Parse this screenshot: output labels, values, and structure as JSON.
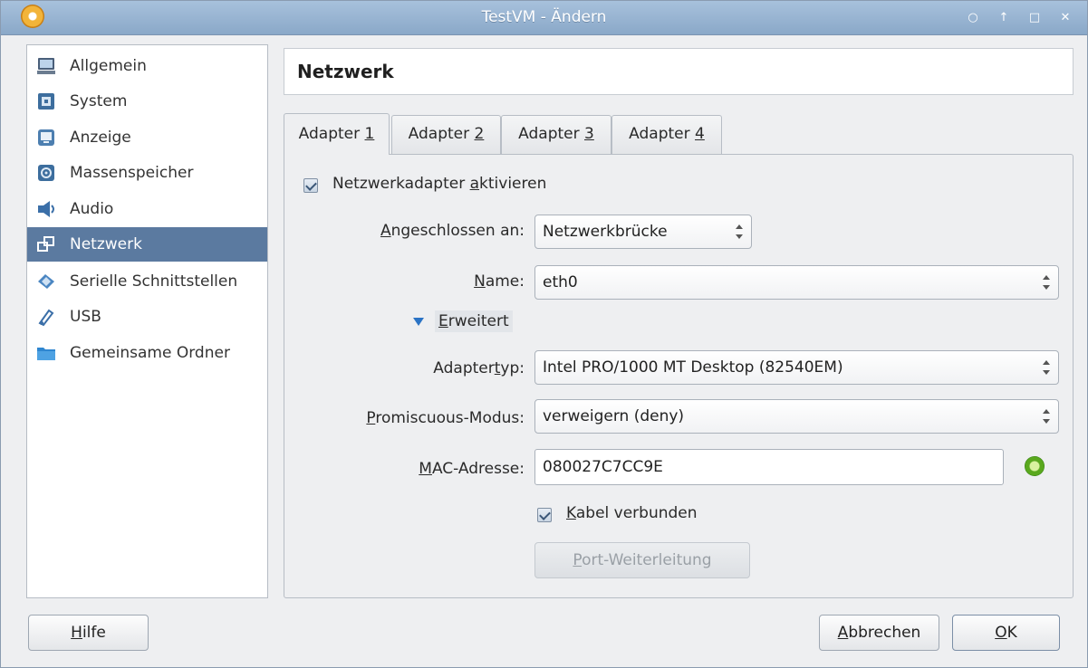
{
  "window": {
    "title": "TestVM - Ändern",
    "controls": [
      "○",
      "↑",
      "□",
      "✕"
    ]
  },
  "sidebar": {
    "items": [
      {
        "label": "Allgemein",
        "icon": "general-icon"
      },
      {
        "label": "System",
        "icon": "system-icon"
      },
      {
        "label": "Anzeige",
        "icon": "display-icon"
      },
      {
        "label": "Massenspeicher",
        "icon": "storage-icon"
      },
      {
        "label": "Audio",
        "icon": "audio-icon"
      },
      {
        "label": "Netzwerk",
        "icon": "network-icon"
      },
      {
        "label": "Serielle Schnittstellen",
        "icon": "serial-ports-icon"
      },
      {
        "label": "USB",
        "icon": "usb-icon"
      },
      {
        "label": "Gemeinsame Ordner",
        "icon": "shared-folders-icon"
      }
    ],
    "selected": "Netzwerk"
  },
  "header": {
    "title": "Netzwerk"
  },
  "tabs": [
    {
      "prefix": "Adapter ",
      "key": "1"
    },
    {
      "prefix": "Adapter ",
      "key": "2"
    },
    {
      "prefix": "Adapter ",
      "key": "3"
    },
    {
      "prefix": "Adapter ",
      "key": "4"
    }
  ],
  "adapter": {
    "enable": {
      "pre": "Netzwerkadapter ",
      "key": "a",
      "post": "ktivieren",
      "checked": true
    },
    "attached": {
      "key": "A",
      "rest": "ngeschlossen an:",
      "value": "Netzwerkbrücke"
    },
    "name": {
      "key": "N",
      "rest": "ame:",
      "value": "eth0"
    },
    "advanced": {
      "key": "E",
      "rest": "rweitert"
    },
    "adapter_type": {
      "pre": "Adapter",
      "key": "t",
      "post": "yp:",
      "value": "Intel PRO/1000 MT Desktop (82540EM)"
    },
    "promiscuous": {
      "key": "P",
      "rest": "romiscuous-Modus:",
      "value": "verweigern (deny)"
    },
    "mac": {
      "key": "M",
      "rest": "AC-Adresse:",
      "value": "080027C7CC9E"
    },
    "cable": {
      "key": "K",
      "rest": "abel verbunden",
      "checked": true
    },
    "port_forwarding": {
      "key": "P",
      "rest": "ort-Weiterleitung",
      "enabled": false
    }
  },
  "footer": {
    "help": {
      "key": "H",
      "rest": "ilfe"
    },
    "cancel": {
      "key": "A",
      "rest": "bbrechen"
    },
    "ok": {
      "key": "O",
      "rest": "K"
    }
  },
  "colors": {
    "titlebar": "#9bb6d4",
    "selection": "#5b7aa0",
    "accent_triangle": "#2a73c5"
  }
}
